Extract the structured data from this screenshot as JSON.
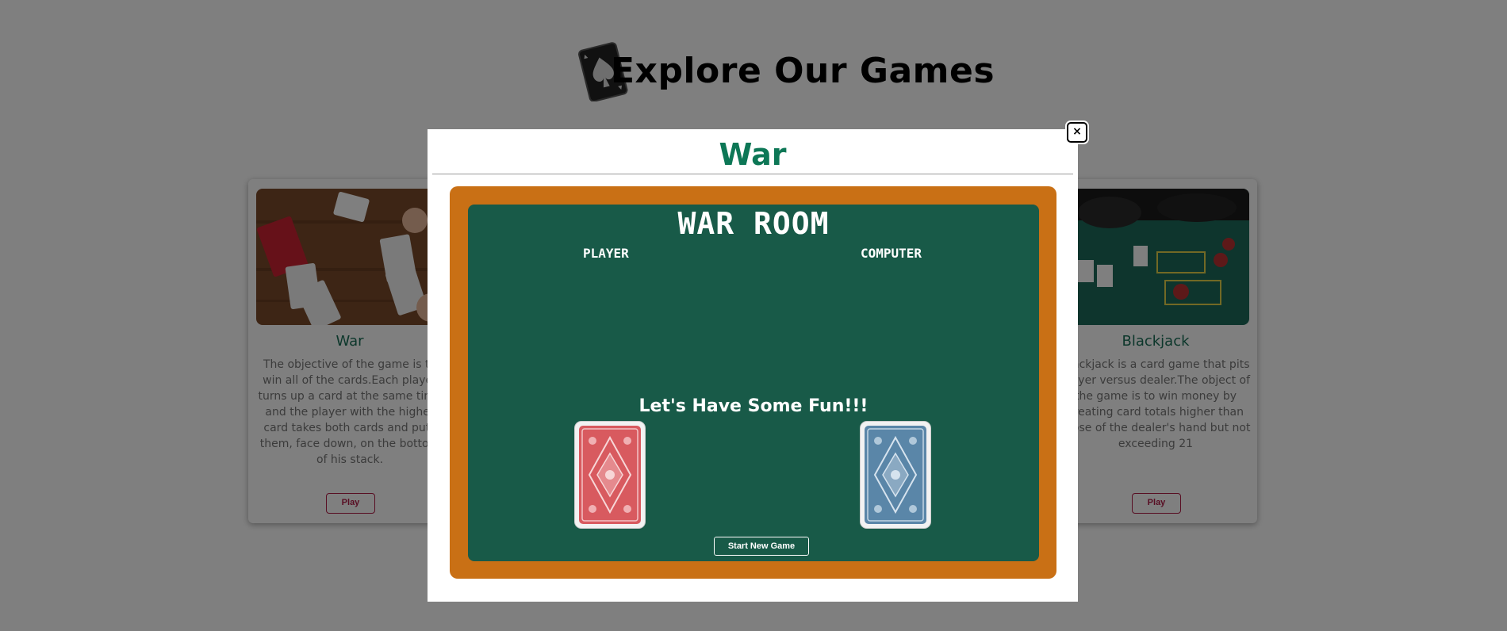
{
  "header": {
    "title": "Explore Our Games",
    "logo_icon": "spade-card-logo-icon"
  },
  "cards": [
    {
      "title": "War",
      "description": "The objective of the game is to win all of the cards.Each player turns up a card at the same time and the player with the higher card takes both cards and puts them, face down, on the bottom of his stack.",
      "play_label": "Play"
    },
    {
      "title": "Blackjack",
      "description": "Blackjack is a card game that pits player versus dealer.The object of the game is to win money by creating card totals higher than those of the dealer's hand but not exceeding 21",
      "play_label": "Play"
    }
  ],
  "modal": {
    "title": "War",
    "close_label": "×",
    "room_title": "WAR ROOM",
    "player_label": "PLAYER",
    "computer_label": "COMPUTER",
    "message": "Let's Have Some Fun!!!",
    "start_label": "Start New Game"
  },
  "colors": {
    "title_green": "#0d7756",
    "table_green": "#185a48",
    "frame_orange": "#c97015",
    "accent_red": "#b01c46"
  }
}
